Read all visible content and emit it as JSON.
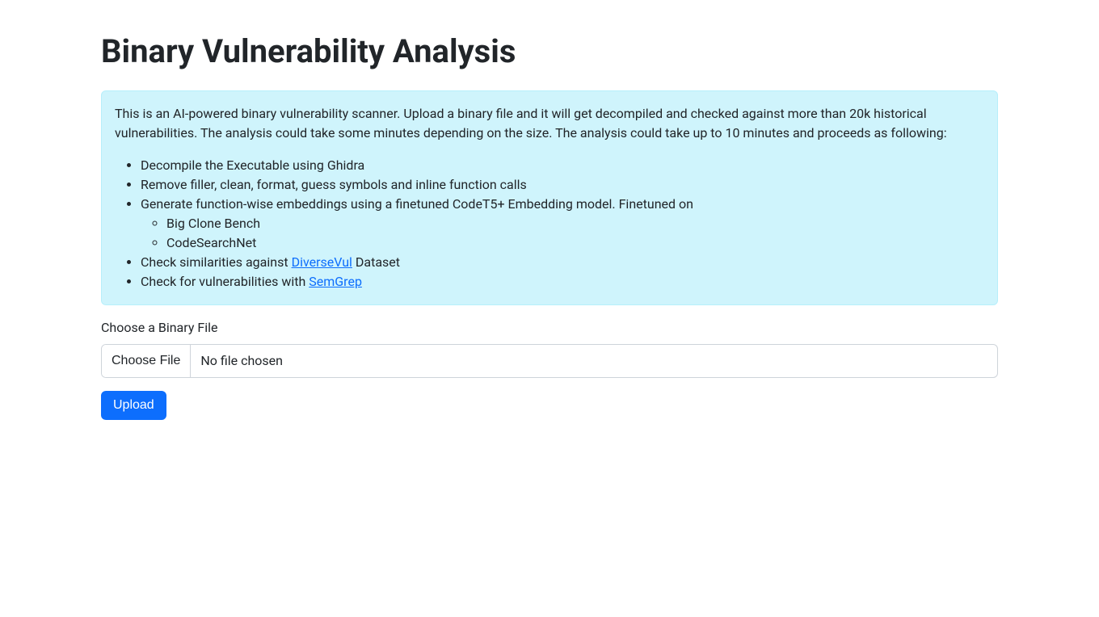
{
  "page": {
    "title": "Binary Vulnerability Analysis"
  },
  "info": {
    "intro": "This is an AI-powered binary vulnerability scanner. Upload a binary file and it will get decompiled and checked against more than 20k historical vulnerabilities. The analysis could take some minutes depending on the size. The analysis could take up to 10 minutes and proceeds as following:",
    "steps": {
      "decompile": "Decompile the Executable using Ghidra",
      "clean": "Remove filler, clean, format, guess symbols and inline function calls",
      "embed": "Generate function-wise embeddings using a finetuned CodeT5+ Embedding model. Finetuned on",
      "sub_big_clone": "Big Clone Bench",
      "sub_codesearch": "CodeSearchNet",
      "check_sim_prefix": "Check similarities against ",
      "check_sim_link": "DiverseVul",
      "check_sim_suffix": " Dataset",
      "check_vuln_prefix": "Check for vulnerabilities with ",
      "check_vuln_link": "SemGrep"
    }
  },
  "form": {
    "file_label": "Choose a Binary File",
    "choose_file_button": "Choose File",
    "no_file_text": "No file chosen",
    "upload_button": "Upload"
  }
}
